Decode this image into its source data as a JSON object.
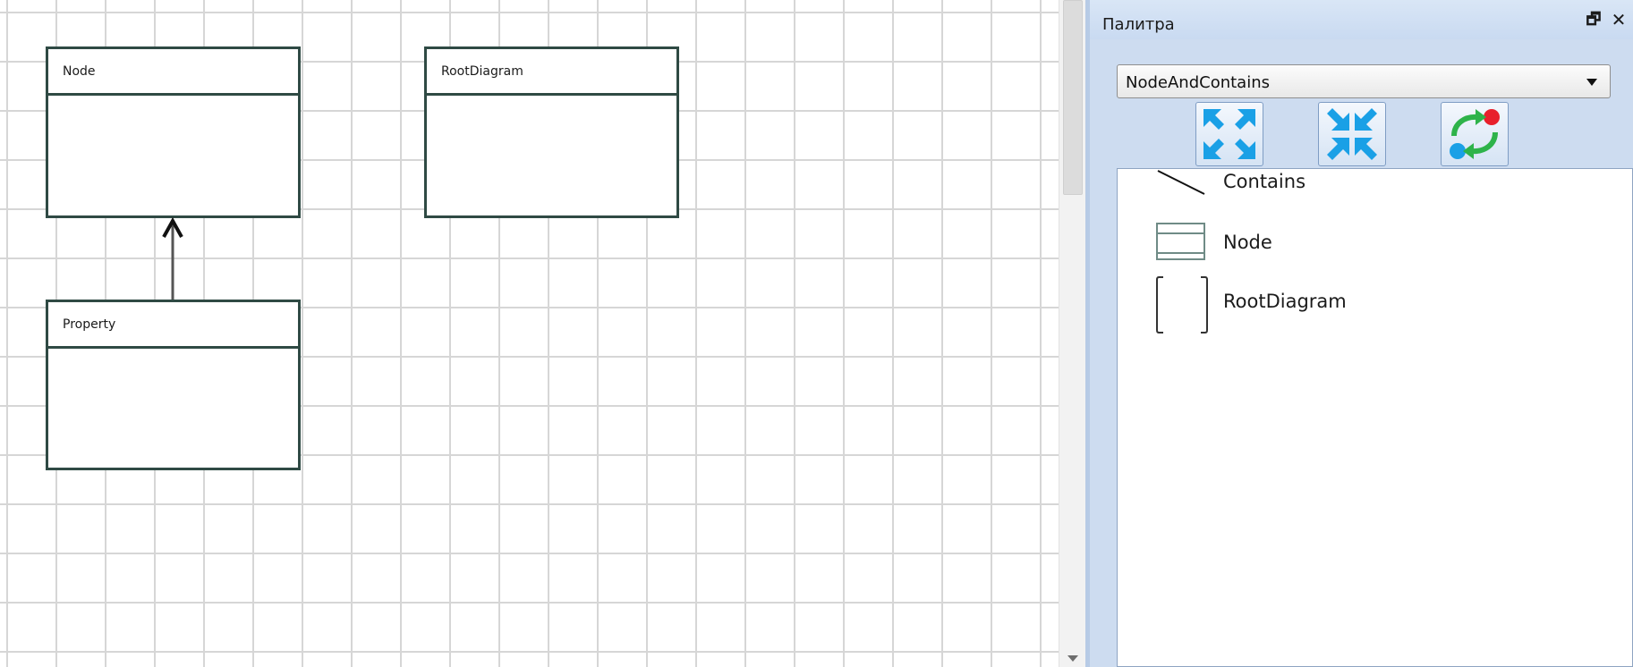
{
  "diagram": {
    "nodes": [
      {
        "name": "Node"
      },
      {
        "name": "RootDiagram"
      },
      {
        "name": "Property"
      }
    ]
  },
  "palette": {
    "title": "Палитра",
    "restore_icon": "restore-window-icon",
    "close_icon": "close-icon",
    "selected_set": "NodeAndContains",
    "toolbar": [
      {
        "icon": "expand-icon"
      },
      {
        "icon": "collapse-icon"
      },
      {
        "icon": "refresh-icon"
      }
    ],
    "items": [
      {
        "label": "Contains",
        "icon": "line-icon"
      },
      {
        "label": "Node",
        "icon": "node-shape-icon"
      },
      {
        "label": "RootDiagram",
        "icon": "container-shape-icon"
      }
    ]
  },
  "colors": {
    "node_border": "#2f4a44",
    "panel_bg": "#cddcf0",
    "icon_blue": "#1aa0e6",
    "icon_green": "#2eb34a",
    "icon_red": "#e8202b"
  }
}
